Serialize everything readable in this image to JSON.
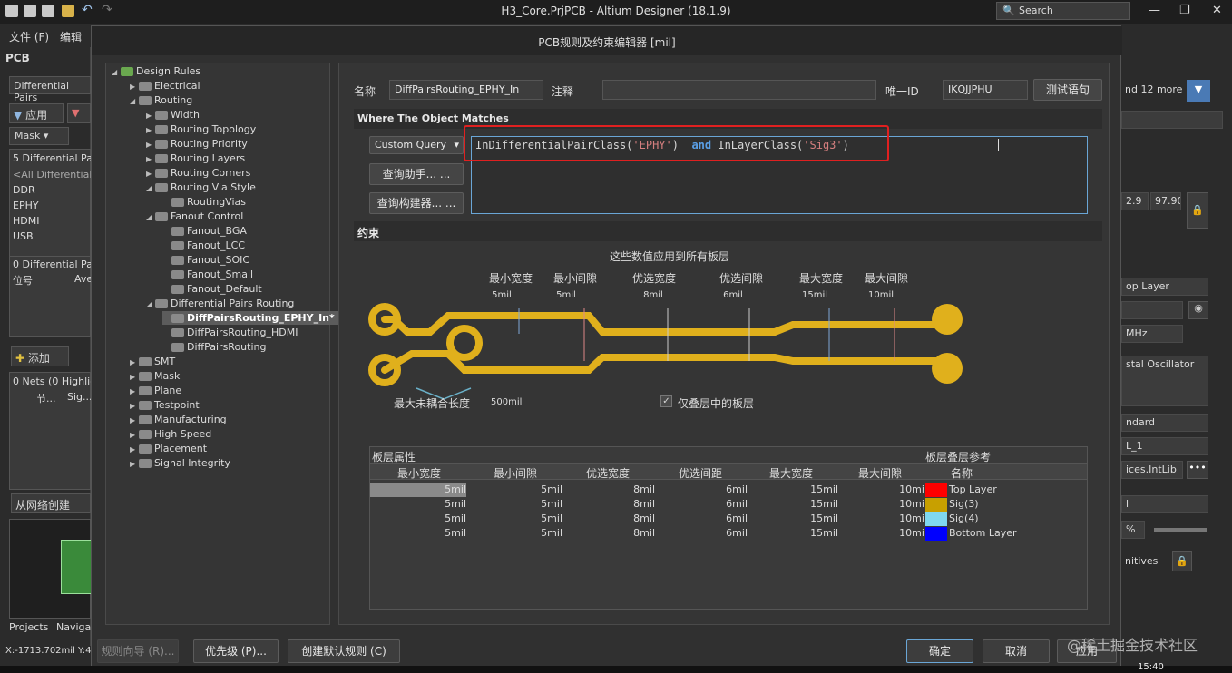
{
  "app": {
    "window_title": "H3_Core.PrjPCB - Altium Designer (18.1.9)",
    "search_placeholder": "Search",
    "menu": [
      "文件 (F)",
      "编辑"
    ],
    "controls": {
      "minimize": "—",
      "restore": "❐",
      "close": "✕"
    }
  },
  "left_panel": {
    "header": "PCB",
    "dropdown": "Differential Pairs",
    "apply_label": "应用",
    "mask_label": "Mask",
    "classes_header": "5 Differential Pai",
    "classes": [
      "<All Differential",
      "DDR",
      "EPHY",
      "HDMI",
      "USB"
    ],
    "pairs_header": "0 Differential Pai",
    "pairs_cols": [
      "位号",
      "Ave"
    ],
    "add_label": "添加",
    "nets_header": "0 Nets (0 Highlig",
    "nets_cols": [
      "节...",
      "Sig..."
    ],
    "create_from_net": "从网络创建",
    "tabs": [
      "Projects",
      "Navigat"
    ],
    "coords": "X:-1713.702mil Y:48"
  },
  "right_panel": {
    "values": [
      "nd 12 more)",
      "2.9",
      "97.90",
      "op Layer",
      "MHz",
      "stal Oscillator",
      "ndard",
      "L_1",
      "ices.IntLib",
      "l",
      "%",
      "nitives"
    ]
  },
  "dialog": {
    "title": "PCB规则及约束编辑器 [mil]",
    "tree": {
      "root": "Design Rules",
      "nodes": [
        {
          "label": "Electrical",
          "level": 1,
          "arrow": "▶"
        },
        {
          "label": "Routing",
          "level": 1,
          "arrow": "◢"
        },
        {
          "label": "Width",
          "level": 2,
          "arrow": "▶"
        },
        {
          "label": "Routing Topology",
          "level": 2,
          "arrow": "▶"
        },
        {
          "label": "Routing Priority",
          "level": 2,
          "arrow": "▶"
        },
        {
          "label": "Routing Layers",
          "level": 2,
          "arrow": "▶"
        },
        {
          "label": "Routing Corners",
          "level": 2,
          "arrow": "▶"
        },
        {
          "label": "Routing Via Style",
          "level": 2,
          "arrow": "◢"
        },
        {
          "label": "RoutingVias",
          "level": 3,
          "arrow": ""
        },
        {
          "label": "Fanout Control",
          "level": 2,
          "arrow": "◢"
        },
        {
          "label": "Fanout_BGA",
          "level": 3,
          "arrow": ""
        },
        {
          "label": "Fanout_LCC",
          "level": 3,
          "arrow": ""
        },
        {
          "label": "Fanout_SOIC",
          "level": 3,
          "arrow": ""
        },
        {
          "label": "Fanout_Small",
          "level": 3,
          "arrow": ""
        },
        {
          "label": "Fanout_Default",
          "level": 3,
          "arrow": ""
        },
        {
          "label": "Differential Pairs Routing",
          "level": 2,
          "arrow": "◢"
        },
        {
          "label": "DiffPairsRouting_EPHY_In*",
          "level": 3,
          "arrow": "",
          "selected": true
        },
        {
          "label": "DiffPairsRouting_HDMI",
          "level": 3,
          "arrow": ""
        },
        {
          "label": "DiffPairsRouting",
          "level": 3,
          "arrow": ""
        },
        {
          "label": "SMT",
          "level": 1,
          "arrow": "▶"
        },
        {
          "label": "Mask",
          "level": 1,
          "arrow": "▶"
        },
        {
          "label": "Plane",
          "level": 1,
          "arrow": "▶"
        },
        {
          "label": "Testpoint",
          "level": 1,
          "arrow": "▶"
        },
        {
          "label": "Manufacturing",
          "level": 1,
          "arrow": "▶"
        },
        {
          "label": "High Speed",
          "level": 1,
          "arrow": "▶"
        },
        {
          "label": "Placement",
          "level": 1,
          "arrow": "▶"
        },
        {
          "label": "Signal Integrity",
          "level": 1,
          "arrow": "▶"
        }
      ]
    },
    "rule": {
      "name_label": "名称",
      "name_value": "DiffPairsRouting_EPHY_In",
      "comment_label": "注释",
      "comment_value": "",
      "uid_label": "唯一ID",
      "uid_value": "IKQJJPHU",
      "test_button": "测试语句",
      "where_header": "Where The Object Matches",
      "query_type": "Custom Query",
      "query_helper": "查询助手... ...",
      "query_builder": "查询构建器... ...",
      "query": {
        "fn1": "InDifferentialPairClass(",
        "arg1": "'EPHY'",
        "close1": ")",
        "kw": "and",
        "fn2": "InLayerClass(",
        "arg2": "'Sig3'",
        "close2": ")"
      }
    },
    "constraints": {
      "header": "约束",
      "caption": "这些数值应用到所有板层",
      "labels": [
        "最小宽度",
        "最小间隙",
        "优选宽度",
        "优选间隙",
        "最大宽度",
        "最大间隙"
      ],
      "values": [
        "5mil",
        "5mil",
        "8mil",
        "6mil",
        "15mil",
        "10mil"
      ],
      "uncoupled_label": "最大未耦合长度",
      "uncoupled_value": "500mil",
      "stack_only_label": "仅叠层中的板层",
      "stack_only_checked": "✓",
      "trace_color": "#e0b01c"
    },
    "layer_table": {
      "props_header": "板层属性",
      "stack_header": "板层叠层参考",
      "columns": [
        "最小宽度",
        "最小间隙",
        "优选宽度",
        "优选间距",
        "最大宽度",
        "最大间隙"
      ],
      "name_col": "名称",
      "rows": [
        {
          "cells": [
            "5mil",
            "5mil",
            "8mil",
            "6mil",
            "15mil",
            "10mil"
          ],
          "name": "Top Layer",
          "color": "#ff0000"
        },
        {
          "cells": [
            "5mil",
            "5mil",
            "8mil",
            "6mil",
            "15mil",
            "10mil"
          ],
          "name": "Sig(3)",
          "color": "#c8a000"
        },
        {
          "cells": [
            "5mil",
            "5mil",
            "8mil",
            "6mil",
            "15mil",
            "10mil"
          ],
          "name": "Sig(4)",
          "color": "#7fd8f0"
        },
        {
          "cells": [
            "5mil",
            "5mil",
            "8mil",
            "6mil",
            "15mil",
            "10mil"
          ],
          "name": "Bottom Layer",
          "color": "#0000ff"
        }
      ]
    },
    "footer": {
      "wizard": "规则向导 (R)...",
      "priority": "优先级 (P)...",
      "create_default": "创建默认规则 (C)",
      "ok": "确定",
      "cancel": "取消",
      "apply": "应用"
    }
  },
  "watermark": "@稀土掘金技术社区",
  "clock": "15:40"
}
